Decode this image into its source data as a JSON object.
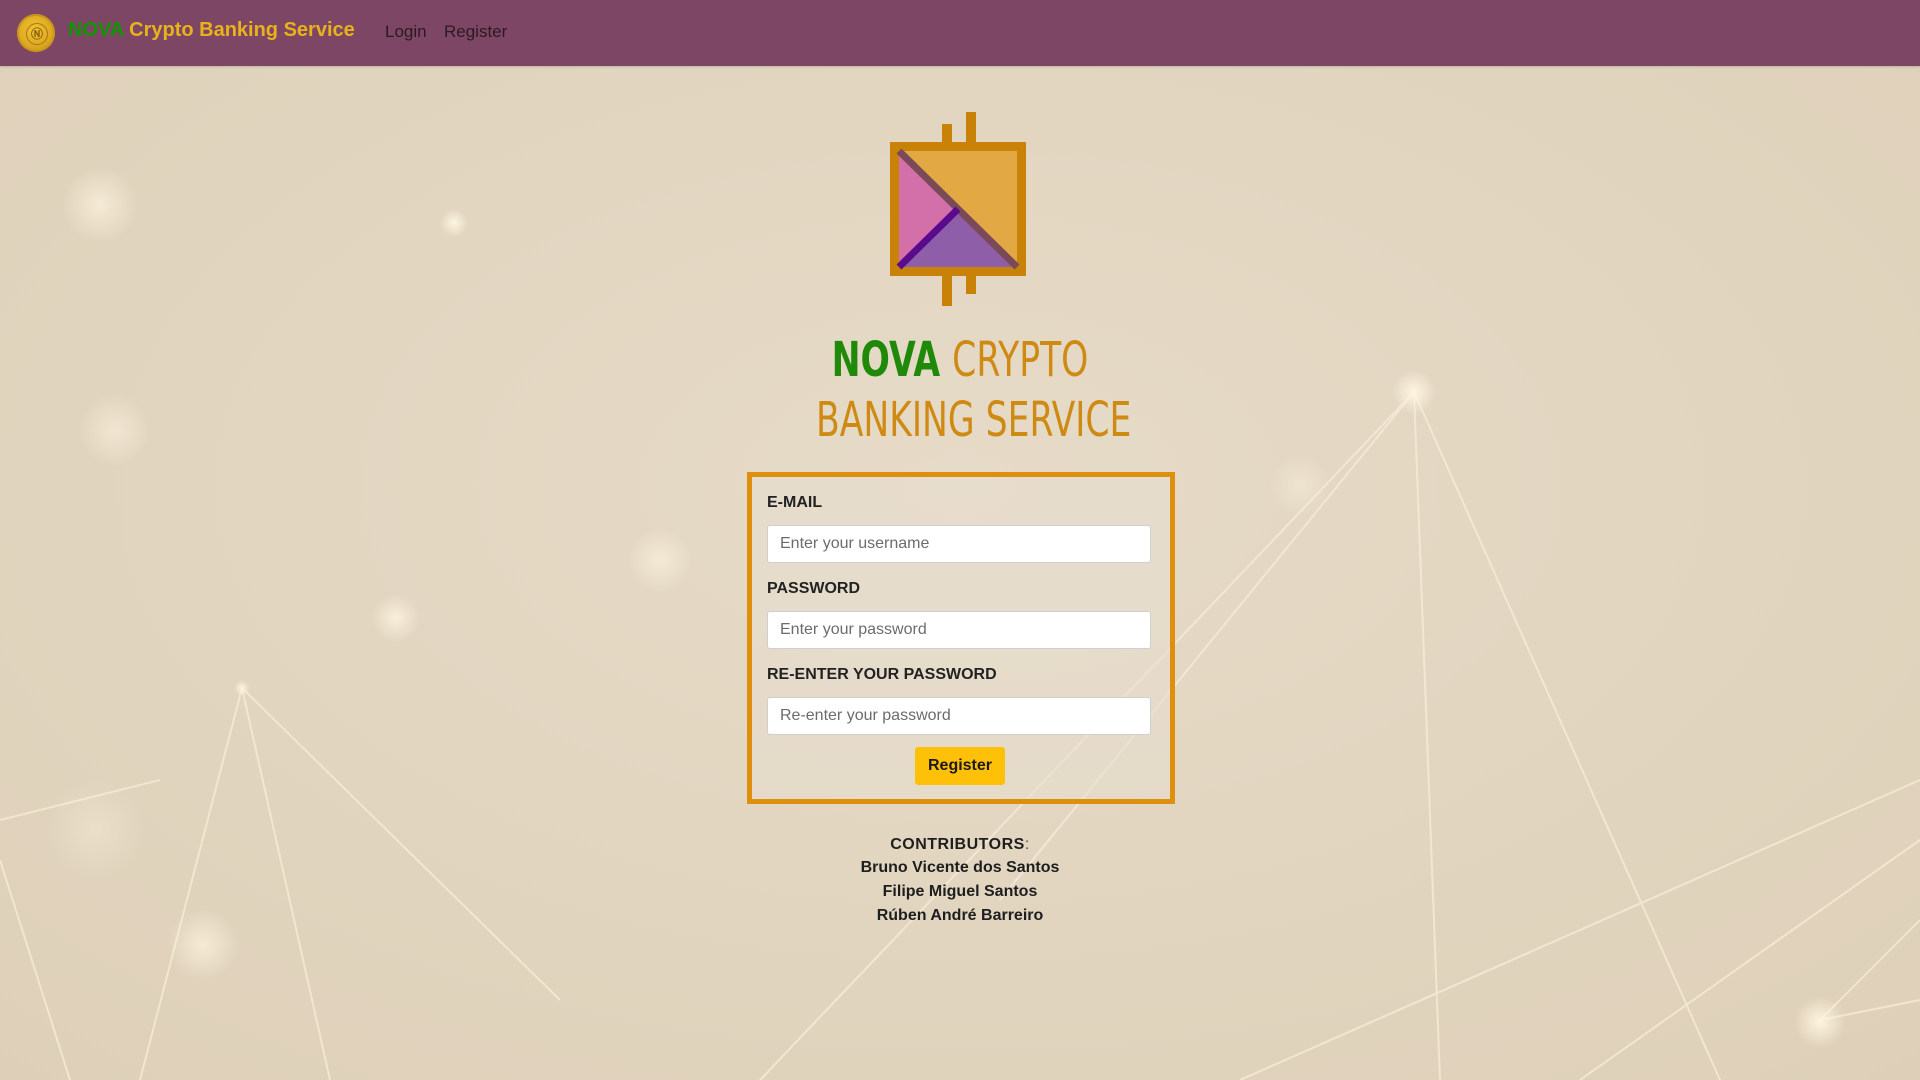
{
  "nav": {
    "brand_nova": "NOVA",
    "brand_rest": "Crypto Banking Service",
    "links": [
      "Login",
      "Register"
    ]
  },
  "hero": {
    "title_nova": "NOVA",
    "title_crypto": "CRYPTO",
    "title_line2": "BANKING SERVICE"
  },
  "form": {
    "email_label": "E-MAIL",
    "email_placeholder": "Enter your username",
    "password_label": "PASSWORD",
    "password_placeholder": "Enter your password",
    "repassword_label": "RE-ENTER YOUR PASSWORD",
    "repassword_placeholder": "Re-enter your password",
    "submit_label": "Register"
  },
  "contributors": {
    "heading": "CONTRIBUTORS",
    "colon": ":",
    "names": [
      "Bruno Vicente dos Santos",
      "Filipe Miguel Santos",
      "Rúben André Barreiro"
    ]
  },
  "colors": {
    "navbar": "#7e4665",
    "brand_green": "#119400",
    "brand_gold": "#e8b21a",
    "form_border": "#de8f0d",
    "button": "#ffc107",
    "background": "#e4d8c4"
  },
  "icons": {
    "nav_logo": "coin-icon",
    "hero_logo": "nova-crypto-logo"
  }
}
